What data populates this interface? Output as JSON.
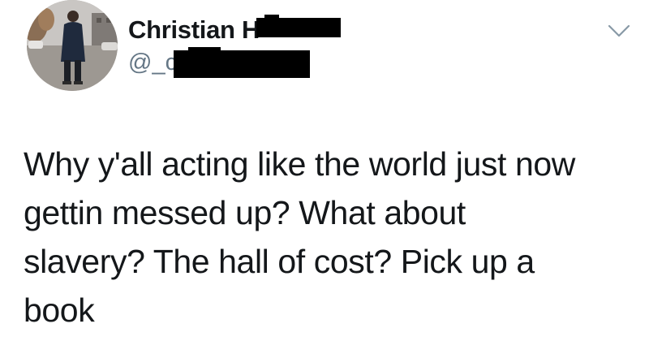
{
  "tweet": {
    "author": {
      "display_name_visible": "Christian H",
      "handle_visible": "@_cl",
      "avatar_icon": "profile-photo-person-in-dark-coat"
    },
    "menu_icon": "chevron-down-icon",
    "text": "Why y'all acting like the world just now\ngettin messed up? What about\nslavery? The hall of cost? Pick up a\nbook"
  },
  "colors": {
    "text": "#14171a",
    "secondary_text": "#657786",
    "redaction": "#000000",
    "background": "#ffffff"
  }
}
